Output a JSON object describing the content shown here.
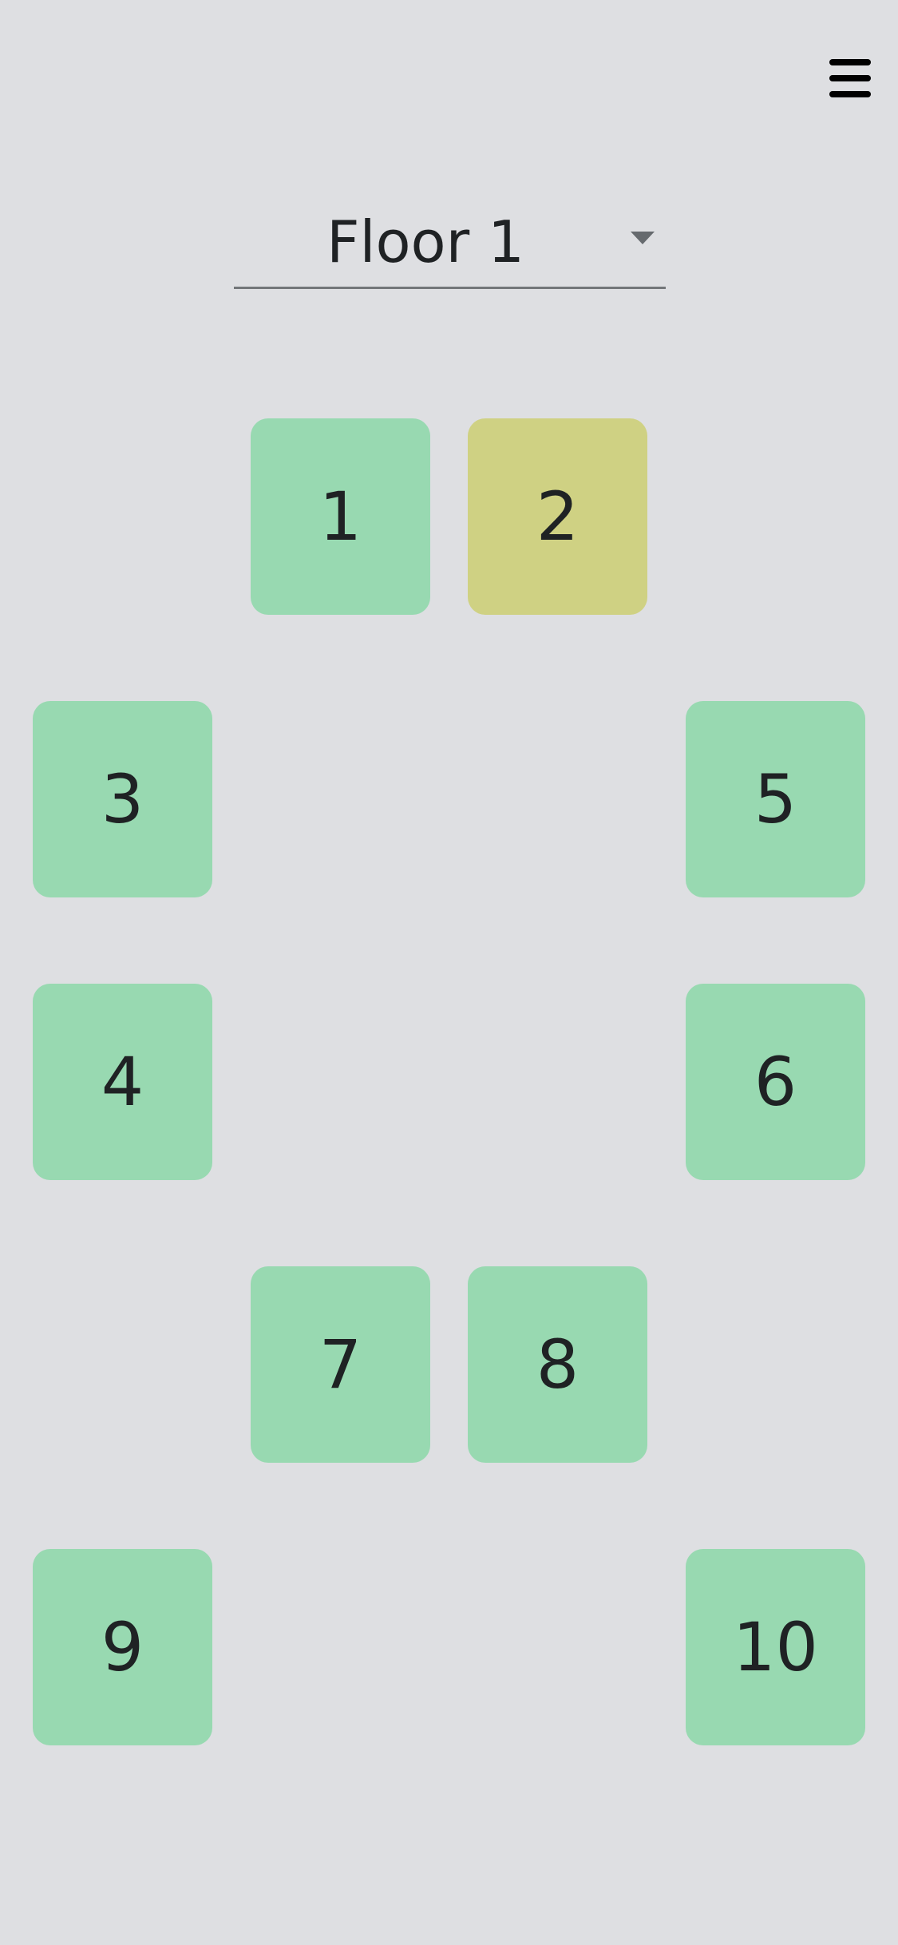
{
  "header": {
    "menu_icon": "hamburger-menu-icon"
  },
  "floor_selector": {
    "selected": "Floor 1",
    "caret_icon": "dropdown-caret-icon"
  },
  "colors": {
    "background": "#dedfe2",
    "room_available": "#98d9b1",
    "room_highlighted": "#cfd183"
  },
  "rooms": [
    {
      "label": "1",
      "status": "available"
    },
    {
      "label": "2",
      "status": "highlighted"
    },
    {
      "label": "3",
      "status": "available"
    },
    {
      "label": "4",
      "status": "available"
    },
    {
      "label": "5",
      "status": "available"
    },
    {
      "label": "6",
      "status": "available"
    },
    {
      "label": "7",
      "status": "available"
    },
    {
      "label": "8",
      "status": "available"
    },
    {
      "label": "9",
      "status": "available"
    },
    {
      "label": "10",
      "status": "available"
    }
  ]
}
